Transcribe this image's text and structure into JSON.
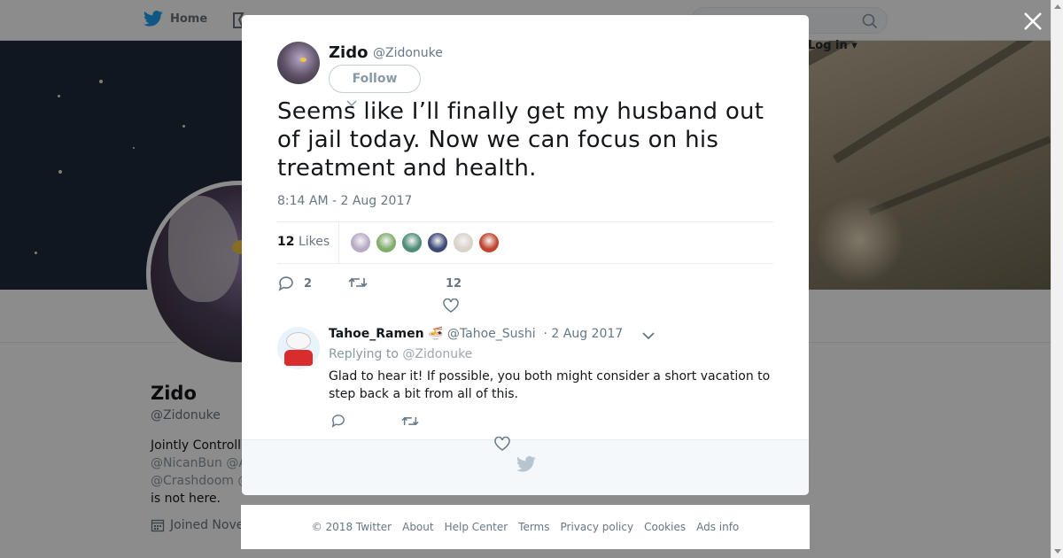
{
  "nav": {
    "home_label": "Home",
    "login_label": "Log in",
    "search": {
      "placeholder": ""
    }
  },
  "profile": {
    "name": "Zido",
    "handle": "@Zidonuke",
    "bio_line1": "Jointly Controll",
    "bio_line2": "@NicanBun @A",
    "bio_line3": "@Crashdoom @",
    "bio_line4": "is not here.",
    "joined": "Joined Nove"
  },
  "tweet": {
    "author_name": "Zido",
    "author_handle": "@Zidonuke",
    "follow_label": "Follow",
    "text": "Seems like I’ll finally get my husband out of jail today. Now we can focus on his treatment and health.",
    "timestamp": "8:14 AM - 2 Aug 2017",
    "likes_count": "12",
    "likes_label": "Likes",
    "reply_count": "2",
    "retweet_count": "",
    "like_count": "12",
    "liker_colors": [
      "#b8a9c4",
      "#7fae6a",
      "#4f8c79",
      "#3d4a78",
      "#d8d2c8",
      "#c3442e"
    ]
  },
  "reply": {
    "name": "Tahoe_Ramen",
    "emoji": "🍜",
    "handle": "@Tahoe_Sushi",
    "date": "· 2 Aug 2017",
    "replying_prefix": "Replying to",
    "replying_to": "@Zidonuke",
    "text": "Glad to hear it! If possible, you both might consider a short vacation to step back a bit from all of this."
  },
  "footer": {
    "links": [
      "© 2018 Twitter",
      "About",
      "Help Center",
      "Terms",
      "Privacy policy",
      "Cookies",
      "Ads info"
    ]
  },
  "colors": {
    "twitter_blue": "#1da1f2",
    "muted_text": "#657786",
    "banner_night": "#1f2a3d",
    "overlay": "rgba(0,0,0,0.45)"
  }
}
